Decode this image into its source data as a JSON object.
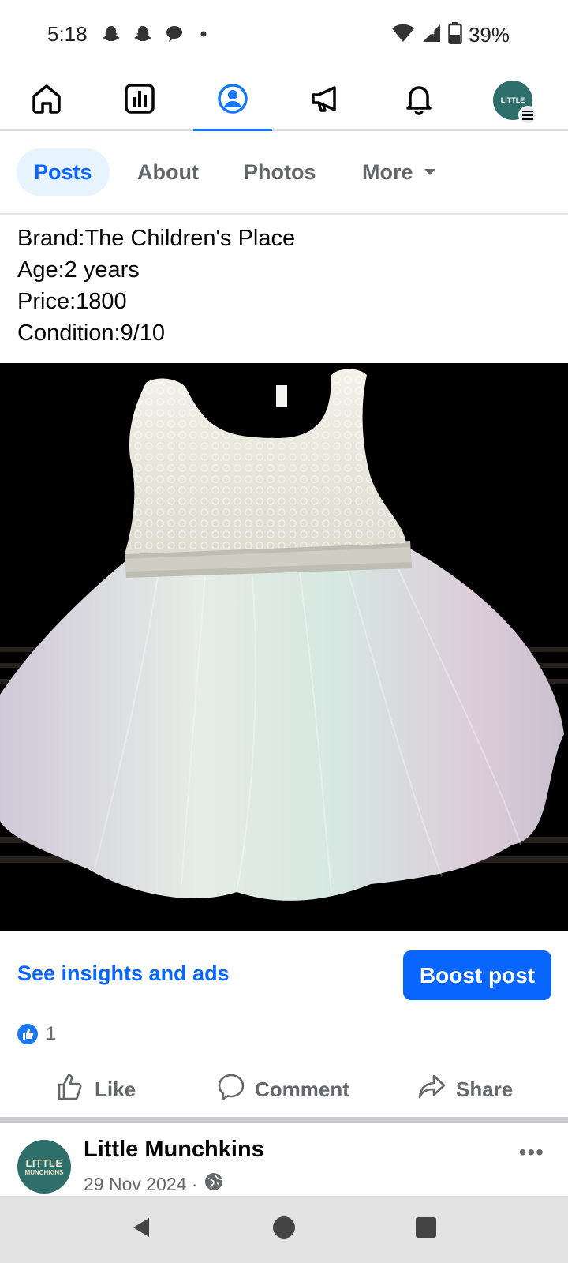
{
  "status_bar": {
    "time": "5:18",
    "battery": "39%",
    "icons": [
      "snapchat-icon",
      "snapchat-icon",
      "chat-bubble-icon",
      "dot-icon",
      "wifi-icon",
      "signal-icon",
      "battery-icon"
    ]
  },
  "top_nav": {
    "items": [
      "home-icon",
      "dashboard-icon",
      "profile-icon",
      "megaphone-icon",
      "bell-icon",
      "avatar"
    ],
    "active": "profile-icon",
    "accent": "#1877f2",
    "avatar_text": "LITTLE"
  },
  "profile_tabs": {
    "tabs": [
      {
        "label": "Posts"
      },
      {
        "label": "About"
      },
      {
        "label": "Photos"
      },
      {
        "label": "More"
      }
    ],
    "active": "Posts"
  },
  "post": {
    "lines": [
      "Brand:The Children's Place",
      "Age:2 years",
      "Price:1800",
      "Condition:9/10"
    ],
    "insights_link": "See insights and ads",
    "boost_label": "Boost post",
    "reaction_count": "1",
    "actions": {
      "like": "Like",
      "comment": "Comment",
      "share": "Share"
    }
  },
  "next_post": {
    "page_name": "Little Munchkins",
    "date": "29 Nov 2024 ·",
    "avatar_line1": "LITTLE",
    "avatar_line2": "MUNCHKINS"
  },
  "colors": {
    "primary": "#0866ff",
    "secondary_text": "#65676b",
    "tab_active_bg": "#e7f3ff"
  }
}
